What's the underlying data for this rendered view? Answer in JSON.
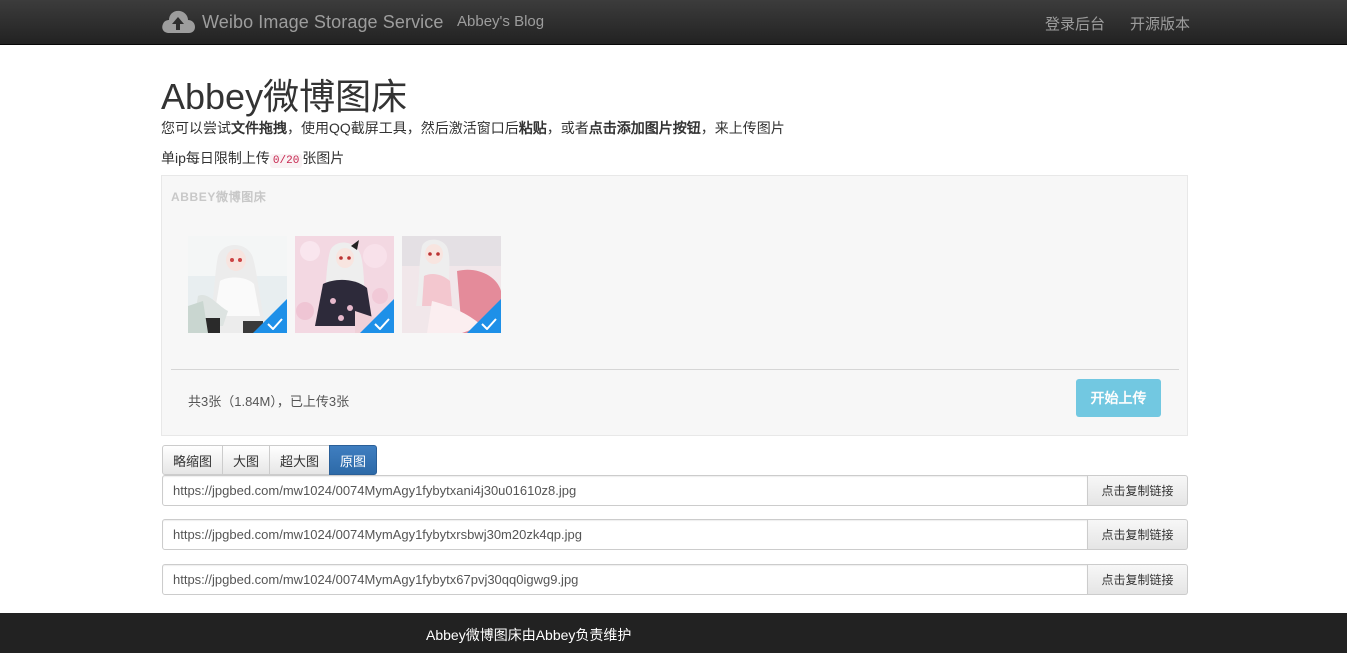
{
  "navbar": {
    "brand": "Weibo Image Storage Service",
    "brand_icon": "cloud-upload-icon",
    "blog_link": "Abbey's Blog",
    "login_link": "登录后台",
    "opensource_link": "开源版本"
  },
  "header": {
    "title": "Abbey微博图床",
    "intro_parts": [
      "您可以尝试",
      "文件拖拽",
      "，使用QQ截屏工具，然后激活窗口后",
      "粘贴",
      "，或者",
      "点击添加图片按钮",
      "，来上传图片"
    ],
    "limit_prefix": "单ip每日限制上传",
    "limit_code": "0/20",
    "limit_suffix": "张图片"
  },
  "uploader": {
    "label": "ABBEY微博图床",
    "thumbnails": [
      {
        "name": "image-1",
        "uploaded": true
      },
      {
        "name": "image-2",
        "uploaded": true
      },
      {
        "name": "image-3",
        "uploaded": true
      }
    ],
    "status": "共3张（1.84M），已上传3张",
    "start_button": "开始上传",
    "accent": "#1e90e8"
  },
  "size_tabs": [
    {
      "label": "略缩图",
      "active": false
    },
    {
      "label": "大图",
      "active": false
    },
    {
      "label": "超大图",
      "active": false
    },
    {
      "label": "原图",
      "active": true
    }
  ],
  "links": [
    {
      "url": "https://jpgbed.com/mw1024/0074MymAgy1fybytxani4j30u01610z8.jpg",
      "button": "点击复制链接"
    },
    {
      "url": "https://jpgbed.com/mw1024/0074MymAgy1fybytxrsbwj30m20zk4qp.jpg",
      "button": "点击复制链接"
    },
    {
      "url": "https://jpgbed.com/mw1024/0074MymAgy1fybytx67pvj30qq0igwg9.jpg",
      "button": "点击复制链接"
    }
  ],
  "footer": {
    "text": "Abbey微博图床由Abbey负责维护"
  }
}
